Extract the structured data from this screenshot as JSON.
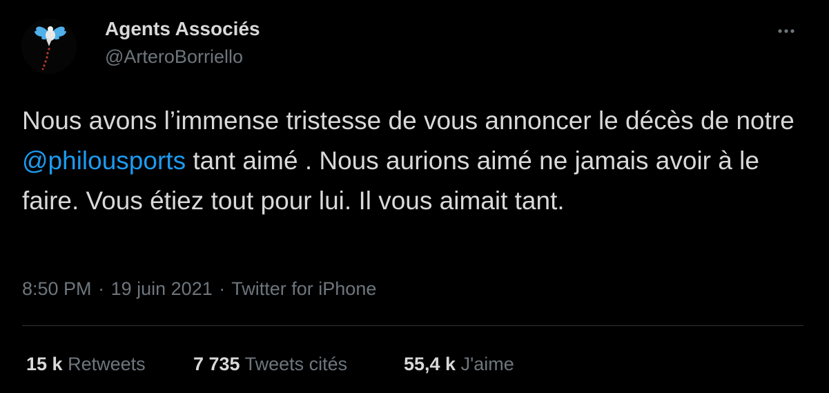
{
  "author": {
    "name": "Agents Associés",
    "handle": "@ArteroBorriello"
  },
  "tweet": {
    "text_before": "Nous avons l’immense tristesse de vous annoncer le décès de notre ",
    "mention": "@philousports",
    "text_after": " tant aimé . Nous aurions aimé ne jamais avoir à le faire. Vous étiez tout pour lui. Il vous aimait tant."
  },
  "meta": {
    "time": "8:50 PM",
    "separator": "·",
    "date": "19 juin 2021",
    "source": "Twitter for iPhone"
  },
  "stats": {
    "retweets": {
      "count": "15 k",
      "label": "Retweets"
    },
    "quotes": {
      "count": "7 735",
      "label": "Tweets cités"
    },
    "likes": {
      "count": "55,4 k",
      "label": "J'aime"
    }
  },
  "colors": {
    "background": "#000000",
    "text": "#d9d9d9",
    "secondary": "#6e767d",
    "link": "#1d9bf0",
    "divider": "#2f3336"
  },
  "icons": {
    "avatar": "angel-bird-avatar",
    "more": "more-dots-icon"
  }
}
